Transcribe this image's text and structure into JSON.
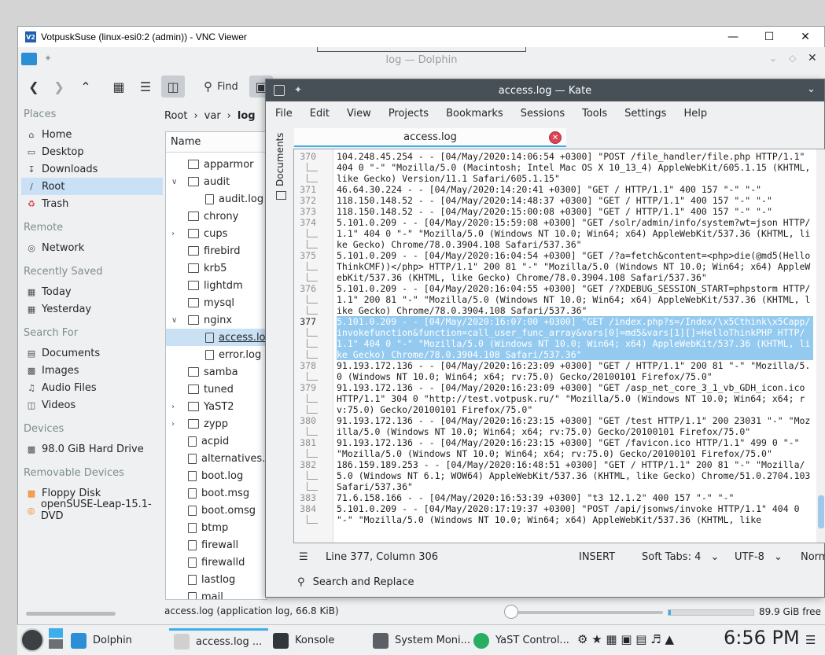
{
  "vnc": {
    "title": "VotpuskSuse (linux-esi0:2 (admin)) - VNC Viewer",
    "logo": "V2"
  },
  "dolphin": {
    "title": "log — Dolphin",
    "toolbar": {
      "find": "Find"
    },
    "places": {
      "header": "Places",
      "items": [
        "Home",
        "Desktop",
        "Downloads",
        "Root",
        "Trash"
      ],
      "remote_header": "Remote",
      "remote_items": [
        "Network"
      ],
      "recent_header": "Recently Saved",
      "recent_items": [
        "Today",
        "Yesterday"
      ],
      "search_header": "Search For",
      "search_items": [
        "Documents",
        "Images",
        "Audio Files",
        "Videos"
      ],
      "devices_header": "Devices",
      "devices_items": [
        "98.0 GiB Hard Drive"
      ],
      "removable_header": "Removable Devices",
      "removable_items": [
        "Floppy Disk",
        "openSUSE-Leap-15.1-DVD"
      ]
    },
    "breadcrumb": [
      "Root",
      "var",
      "log"
    ],
    "column_name": "Name",
    "tree": [
      {
        "name": "apparmor",
        "type": "folder"
      },
      {
        "name": "audit",
        "type": "folder"
      },
      {
        "name": "audit.log",
        "type": "doc"
      },
      {
        "name": "chrony",
        "type": "folder"
      },
      {
        "name": "cups",
        "type": "folder"
      },
      {
        "name": "firebird",
        "type": "folder"
      },
      {
        "name": "krb5",
        "type": "folder"
      },
      {
        "name": "lightdm",
        "type": "folder"
      },
      {
        "name": "mysql",
        "type": "folder"
      },
      {
        "name": "nginx",
        "type": "folder"
      },
      {
        "name": "access.log",
        "type": "doc"
      },
      {
        "name": "error.log",
        "type": "doc"
      },
      {
        "name": "samba",
        "type": "folder"
      },
      {
        "name": "tuned",
        "type": "folder"
      },
      {
        "name": "YaST2",
        "type": "folder"
      },
      {
        "name": "zypp",
        "type": "folder"
      },
      {
        "name": "acpid",
        "type": "doc"
      },
      {
        "name": "alternatives.log",
        "type": "doc"
      },
      {
        "name": "boot.log",
        "type": "doc"
      },
      {
        "name": "boot.msg",
        "type": "doc"
      },
      {
        "name": "boot.omsg",
        "type": "doc"
      },
      {
        "name": "btmp",
        "type": "doc"
      },
      {
        "name": "firewall",
        "type": "doc"
      },
      {
        "name": "firewalld",
        "type": "doc"
      },
      {
        "name": "lastlog",
        "type": "doc"
      },
      {
        "name": "mail",
        "type": "doc"
      }
    ],
    "status": "access.log (application log, 66.8 KiB)",
    "free": "89.9 GiB free",
    "free_fraction": 0.03
  },
  "kate": {
    "title": "access.log — Kate",
    "menu": [
      "File",
      "Edit",
      "View",
      "Projects",
      "Bookmarks",
      "Sessions",
      "Tools",
      "Settings",
      "Help"
    ],
    "side_label": "Documents",
    "tab": "access.log",
    "lines": [
      {
        "n": "370",
        "text": "104.248.45.254 - - [04/May/2020:14:06:54 +0300] \"POST /file_handler/file.php HTTP/1.1\" 404 0 \"-\" \"Mozilla/5.0 (Macintosh; Intel Mac OS X 10_13_4) AppleWebKit/605.1.15 (KHTML, like Gecko) Version/11.1 Safari/605.1.15\""
      },
      {
        "n": "371",
        "text": "46.64.30.224 - - [04/May/2020:14:20:41 +0300] \"GET / HTTP/1.1\" 400 157 \"-\" \"-\""
      },
      {
        "n": "372",
        "text": "118.150.148.52 - - [04/May/2020:14:48:37 +0300] \"GET / HTTP/1.1\" 400 157 \"-\" \"-\""
      },
      {
        "n": "373",
        "text": "118.150.148.52 - - [04/May/2020:15:00:08 +0300] \"GET / HTTP/1.1\" 400 157 \"-\" \"-\""
      },
      {
        "n": "374",
        "text": "5.101.0.209 - - [04/May/2020:15:59:08 +0300] \"GET /solr/admin/info/system?wt=json HTTP/1.1\" 404 0 \"-\" \"Mozilla/5.0 (Windows NT 10.0; Win64; x64) AppleWebKit/537.36 (KHTML, like Gecko) Chrome/78.0.3904.108 Safari/537.36\""
      },
      {
        "n": "375",
        "text": "5.101.0.209 - - [04/May/2020:16:04:54 +0300] \"GET /?a=fetch&content=<php>die(@md5(HelloThinkCMF))</php> HTTP/1.1\" 200 81 \"-\" \"Mozilla/5.0 (Windows NT 10.0; Win64; x64) AppleWebKit/537.36 (KHTML, like Gecko) Chrome/78.0.3904.108 Safari/537.36\""
      },
      {
        "n": "376",
        "text": "5.101.0.209 - - [04/May/2020:16:04:55 +0300] \"GET /?XDEBUG_SESSION_START=phpstorm HTTP/1.1\" 200 81 \"-\" \"Mozilla/5.0 (Windows NT 10.0; Win64; x64) AppleWebKit/537.36 (KHTML, like Gecko) Chrome/78.0.3904.108 Safari/537.36\""
      },
      {
        "n": "377",
        "text": "5.101.0.209 - - [04/May/2020:16:07:00 +0300] \"GET /index.php?s=/Index/\\x5Cthink\\x5Capp/invokefunction&function=call_user_func_array&vars[0]=md5&vars[1][]=HelloThinkPHP HTTP/1.1\" 404 0 \"-\" \"Mozilla/5.0 (Windows NT 10.0; Win64; x64) AppleWebKit/537.36 (KHTML, like Gecko) Chrome/78.0.3904.108 Safari/537.36\""
      },
      {
        "n": "378",
        "text": "91.193.172.136 - - [04/May/2020:16:23:09 +0300] \"GET / HTTP/1.1\" 200 81 \"-\" \"Mozilla/5.0 (Windows NT 10.0; Win64; x64; rv:75.0) Gecko/20100101 Firefox/75.0\""
      },
      {
        "n": "379",
        "text": "91.193.172.136 - - [04/May/2020:16:23:09 +0300] \"GET /asp_net_core_3_1_vb_GDH_icon.ico HTTP/1.1\" 304 0 \"http://test.votpusk.ru/\" \"Mozilla/5.0 (Windows NT 10.0; Win64; x64; rv:75.0) Gecko/20100101 Firefox/75.0\""
      },
      {
        "n": "380",
        "text": "91.193.172.136 - - [04/May/2020:16:23:15 +0300] \"GET /test HTTP/1.1\" 200 23031 \"-\" \"Mozilla/5.0 (Windows NT 10.0; Win64; x64; rv:75.0) Gecko/20100101 Firefox/75.0\""
      },
      {
        "n": "381",
        "text": "91.193.172.136 - - [04/May/2020:16:23:15 +0300] \"GET /favicon.ico HTTP/1.1\" 499 0 \"-\" \"Mozilla/5.0 (Windows NT 10.0; Win64; x64; rv:75.0) Gecko/20100101 Firefox/75.0\""
      },
      {
        "n": "382",
        "text": "186.159.189.253 - - [04/May/2020:16:48:51 +0300] \"GET / HTTP/1.1\" 200 81 \"-\" \"Mozilla/5.0 (Windows NT 6.1; WOW64) AppleWebKit/537.36 (KHTML, like Gecko) Chrome/51.0.2704.103 Safari/537.36\""
      },
      {
        "n": "383",
        "text": "71.6.158.166 - - [04/May/2020:16:53:39 +0300] \"t3 12.1.2\" 400 157 \"-\" \"-\""
      },
      {
        "n": "384",
        "text": "5.101.0.209 - - [04/May/2020:17:19:37 +0300] \"POST /api/jsonws/invoke HTTP/1.1\" 404 0 \"-\" \"Mozilla/5.0 (Windows NT 10.0; Win64; x64) AppleWebKit/537.36 (KHTML, like"
      }
    ],
    "status": {
      "position": "Line 377, Column 306",
      "mode": "INSERT",
      "tabs": "Soft Tabs: 4",
      "encoding": "UTF-8",
      "syntax": "Norm"
    },
    "search": "Search and Replace"
  },
  "taskbar": {
    "tasks": [
      "Dolphin",
      "access.log ...",
      "Konsole",
      "System Moni...",
      "YaST Control..."
    ],
    "clock": "6:56 PM"
  }
}
